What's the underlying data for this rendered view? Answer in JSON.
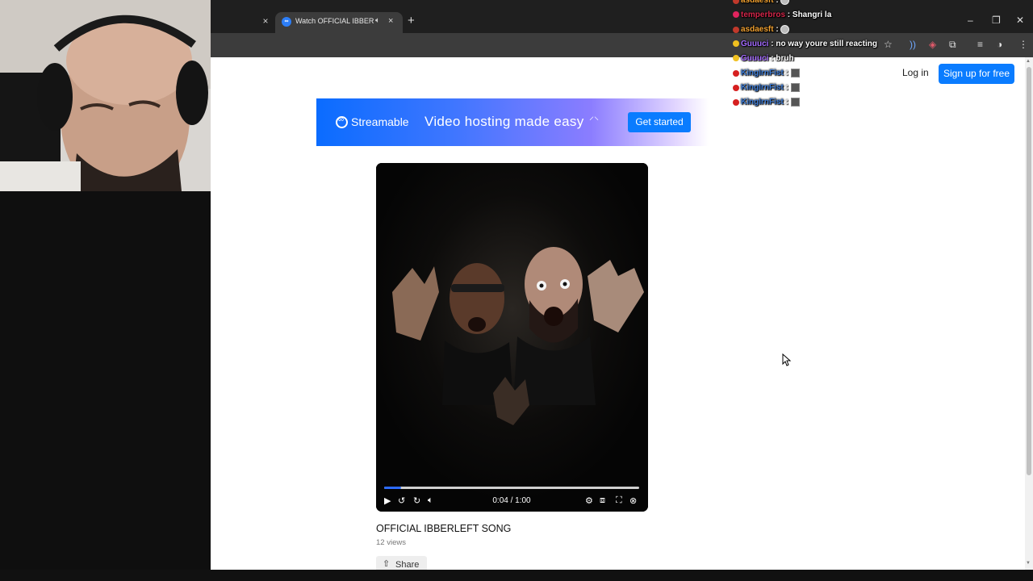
{
  "browser": {
    "tab_title": "Watch OFFICIAL IBBERLEFT",
    "new_tab": "+",
    "close_glyph": "×",
    "window_controls": [
      "–",
      "❐",
      "✕"
    ]
  },
  "site": {
    "login_label": "Log in",
    "signup_label": "Sign up for free",
    "banner": {
      "brand": "Streamable",
      "headline": "Video hosting made easy",
      "cta_label": "Get started"
    },
    "player": {
      "time": "0:04 / 1:00",
      "progress_percent": 6.7
    },
    "video_title": "OFFICIAL IBBERLEFT SONG",
    "views": "12 views",
    "share_label": "Share"
  },
  "chat": {
    "messages": [
      {
        "user": "asdaesft",
        "color": "#f0a030",
        "badge_color": "#c0392b",
        "text": "",
        "emote": "round"
      },
      {
        "user": "temperbros",
        "color": "#d4264a",
        "badge_color": "#e0245e",
        "text": "Shangri la",
        "emote": ""
      },
      {
        "user": "asdaesft",
        "color": "#f0a030",
        "badge_color": "#c0392b",
        "text": "",
        "emote": "round"
      },
      {
        "user": "Guuuci",
        "color": "#a46bff",
        "badge_color": "#f0c020",
        "text": "no way youre still reacting",
        "emote": ""
      },
      {
        "user": "Guuuci",
        "color": "#a46bff",
        "badge_color": "#f0c020",
        "text": "bruh",
        "emote": ""
      },
      {
        "user": "KingIrnFist",
        "color": "#3e7cd6",
        "badge_color": "#d62020",
        "text": "",
        "emote": "square"
      },
      {
        "user": "KingIrnFist",
        "color": "#3e7cd6",
        "badge_color": "#d62020",
        "text": "",
        "emote": "square"
      },
      {
        "user": "KingIrnFist",
        "color": "#3e7cd6",
        "badge_color": "#d62020",
        "text": "",
        "emote": "square"
      }
    ]
  }
}
